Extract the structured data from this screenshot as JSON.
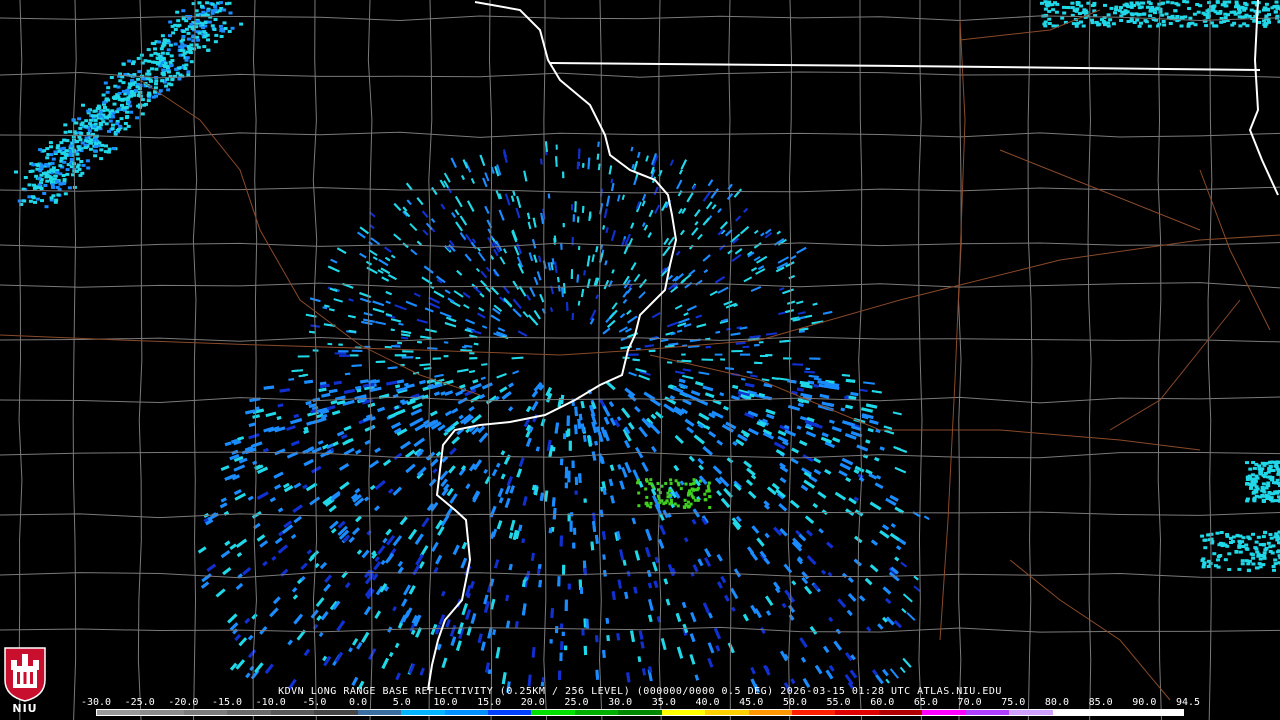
{
  "product": {
    "title": "KDVN LONG RANGE BASE REFLECTIVITY (0.25KM / 256 LEVEL) (000000/0000 0.5 DEG) 2026-03-15 01:28 UTC  ATLAS.NIU.EDU"
  },
  "scale": {
    "labels": [
      "-30.0",
      "-25.0",
      "-20.0",
      "-15.0",
      "-10.0",
      "-5.0",
      "0.0",
      "5.0",
      "10.0",
      "15.0",
      "20.0",
      "25.0",
      "30.0",
      "35.0",
      "40.0",
      "45.0",
      "50.0",
      "55.0",
      "60.0",
      "65.0",
      "70.0",
      "75.0",
      "80.0",
      "85.0",
      "90.0",
      "94.5"
    ],
    "colors": [
      "#9a9a9a",
      "#8c8c8c",
      "#7c7c7c",
      "#6a6a6a",
      "#585858",
      "#464646",
      "#3a6ea0",
      "#00b4ff",
      "#0090ff",
      "#0040ff",
      "#00e000",
      "#00b000",
      "#008800",
      "#ffff00",
      "#ffd000",
      "#ff9800",
      "#ff2000",
      "#e00000",
      "#b00000",
      "#ff00ff",
      "#b040ff",
      "#d0a0ff",
      "#ffffff",
      "#ffffff",
      "#ffffff"
    ]
  },
  "logo": {
    "text": "NIU",
    "colors": {
      "red": "#c8102e",
      "white": "#ffffff"
    }
  },
  "map_colors": {
    "state_border": "#ffffff",
    "county_line": "#7a7a7a",
    "road": "#8a4a2a",
    "echo_light": "#20d8e8",
    "echo_mid": "#1a8cff",
    "echo_deep": "#1030d0",
    "echo_green": "#40d020"
  }
}
